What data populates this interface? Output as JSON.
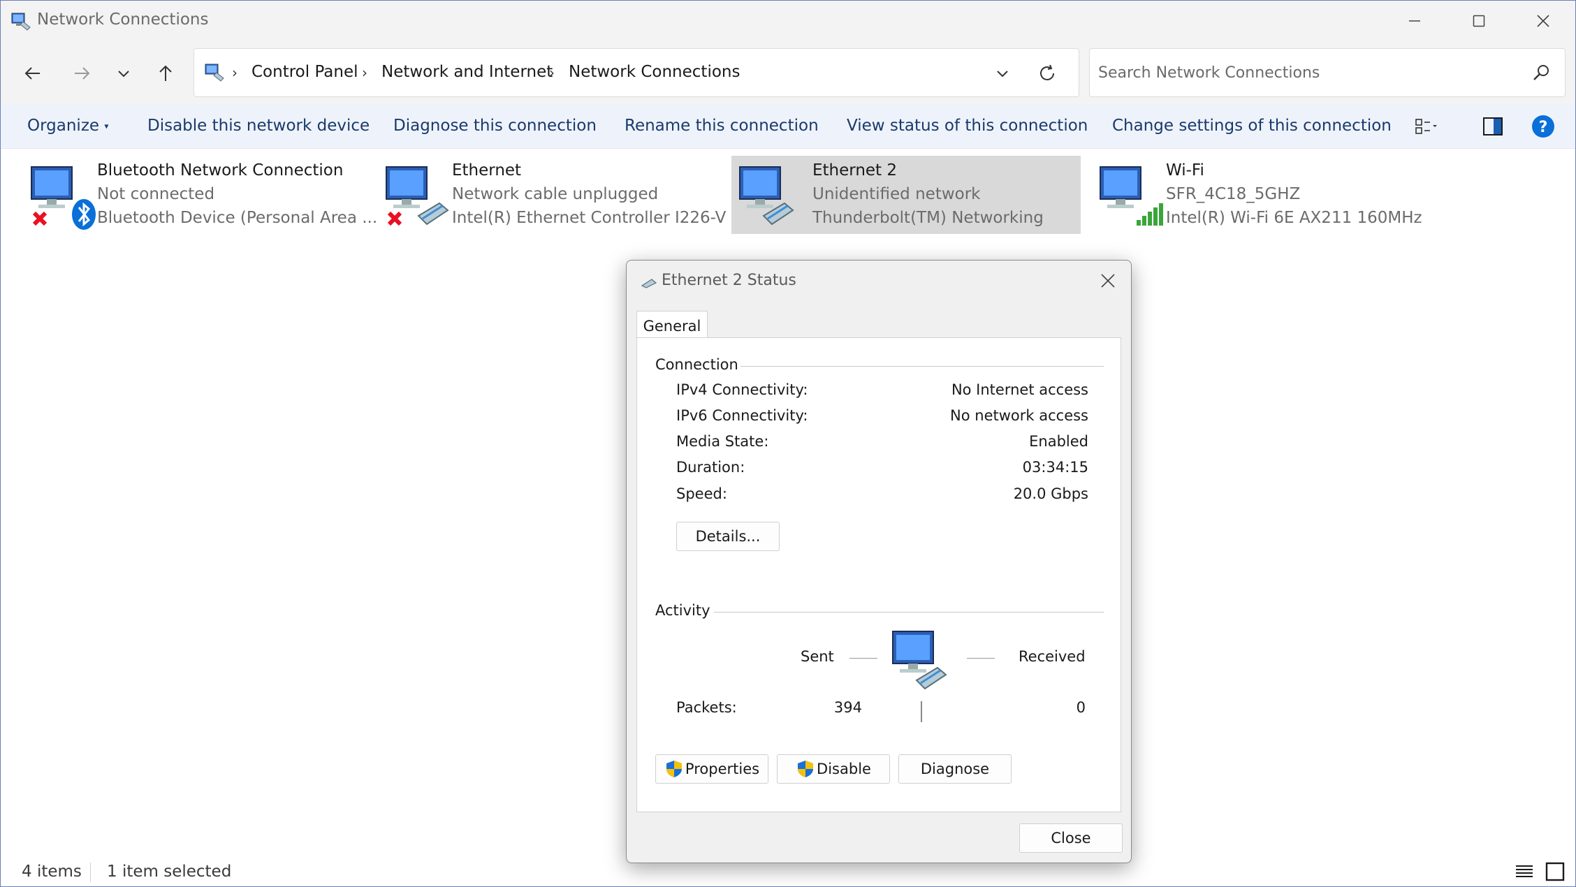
{
  "window": {
    "title": "Network Connections"
  },
  "nav": {
    "breadcrumbs": [
      "Control Panel",
      "Network and Internet",
      "Network Connections"
    ],
    "search_placeholder": "Search Network Connections"
  },
  "commands": {
    "organize": "Organize",
    "disable": "Disable this network device",
    "diagnose": "Diagnose this connection",
    "rename": "Rename this connection",
    "view_status": "View status of this connection",
    "change_settings": "Change settings of this connection"
  },
  "connections": [
    {
      "name": "Bluetooth Network Connection",
      "status": "Not connected",
      "device": "Bluetooth Device (Personal Area ..."
    },
    {
      "name": "Ethernet",
      "status": "Network cable unplugged",
      "device": "Intel(R) Ethernet Controller I226-V"
    },
    {
      "name": "Ethernet 2",
      "status": "Unidentified network",
      "device": "Thunderbolt(TM) Networking"
    },
    {
      "name": "Wi-Fi",
      "status": "SFR_4C18_5GHZ",
      "device": "Intel(R) Wi-Fi 6E AX211 160MHz"
    }
  ],
  "statusbar": {
    "items": "4 items",
    "selected": "1 item selected"
  },
  "dialog": {
    "title": "Ethernet 2 Status",
    "tab": "General",
    "connection_label": "Connection",
    "rows": [
      {
        "label": "IPv4 Connectivity:",
        "value": "No Internet access"
      },
      {
        "label": "IPv6 Connectivity:",
        "value": "No network access"
      },
      {
        "label": "Media State:",
        "value": "Enabled"
      },
      {
        "label": "Duration:",
        "value": "03:34:15"
      },
      {
        "label": "Speed:",
        "value": "20.0 Gbps"
      }
    ],
    "details_button": "Details...",
    "activity_label": "Activity",
    "sent_label": "Sent",
    "received_label": "Received",
    "packets_label": "Packets:",
    "packets_sent": "394",
    "packets_received": "0",
    "properties_button": "Properties",
    "disable_button": "Disable",
    "diagnose_button": "Diagnose",
    "close_button": "Close"
  },
  "colors": {
    "accent": "#0067c0",
    "selected_bg": "#d9d9d9",
    "error_red": "#e81123",
    "wifi_green": "#3aa53a"
  }
}
